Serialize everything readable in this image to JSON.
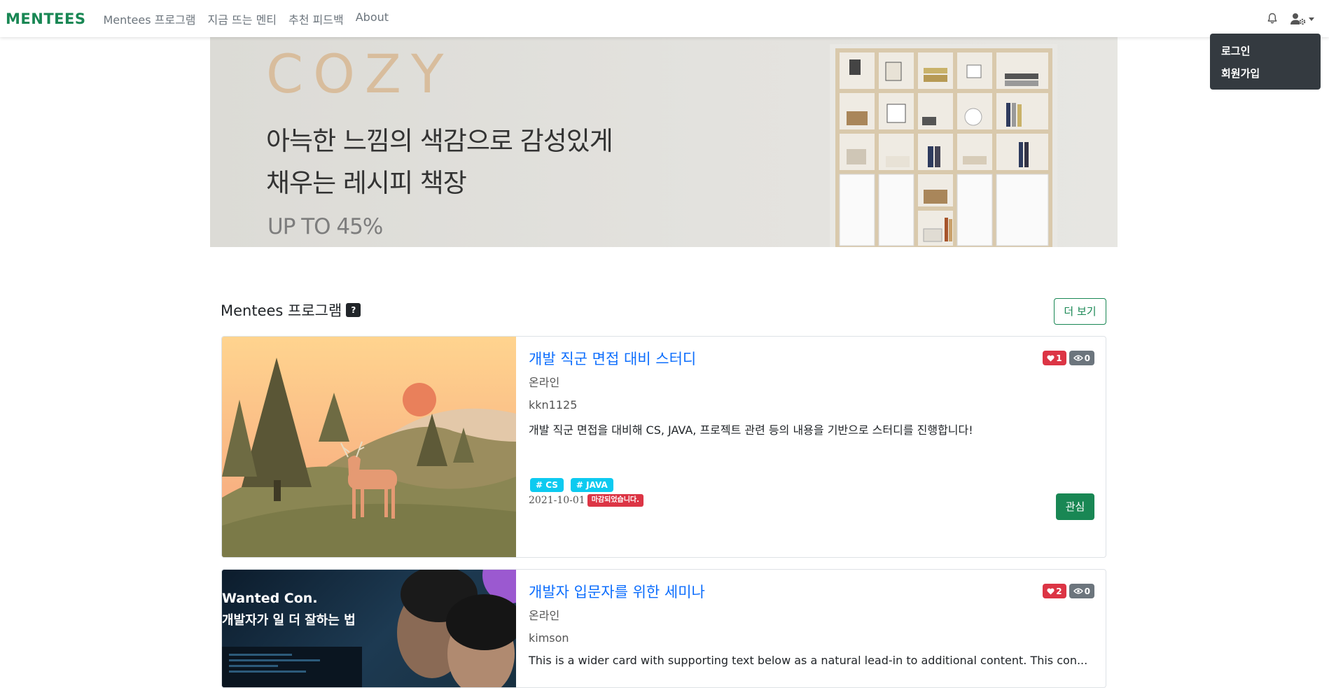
{
  "navbar": {
    "brand": "MENTEES",
    "links": [
      "Mentees 프로그램",
      "지금 뜨는 멘티",
      "추천 피드백",
      "About"
    ]
  },
  "user_menu": {
    "items": [
      "로그인",
      "회원가입"
    ]
  },
  "banner": {
    "headline": "COZY",
    "line1": "아늑한 느낌의 색감으로 감성있게",
    "line2": "채우는 레시피 책장",
    "promo": "UP TO 45%"
  },
  "section": {
    "title": "Mentees 프로그램",
    "help_badge": "?",
    "more_label": "더 보기"
  },
  "cards": [
    {
      "title": "개발 직군 면접 대비 스터디",
      "mode": "온라인",
      "author": "kkn1125",
      "description": "개발 직군 면접을 대비해 CS, JAVA, 프로젝트 관련 등의 내용을 기반으로 스터디를 진행합니다!",
      "likes": "1",
      "views": "0",
      "tags": [
        "# CS",
        "# JAVA"
      ],
      "date": "2021-10-01",
      "status": "마감되었습니다.",
      "action_label": "관심"
    },
    {
      "title": "개발자 입문자를 위한 세미나",
      "mode": "온라인",
      "author": "kimson",
      "description": "This is a wider card with supporting text below as a natural lead-in to additional content. This con...",
      "likes": "2",
      "views": "0",
      "image_text_1": "Wanted Con.",
      "image_text_2": "개발자가 일 더 잘하는 법"
    }
  ],
  "colors": {
    "brand": "#198754",
    "primary": "#0d6efd",
    "danger": "#dc3545",
    "info": "#0dcaf0",
    "secondary": "#6c757d",
    "dark": "#343a40"
  },
  "icons": [
    "bell-icon",
    "user-gear-icon",
    "caret-down-icon",
    "heart-icon",
    "eye-icon"
  ]
}
